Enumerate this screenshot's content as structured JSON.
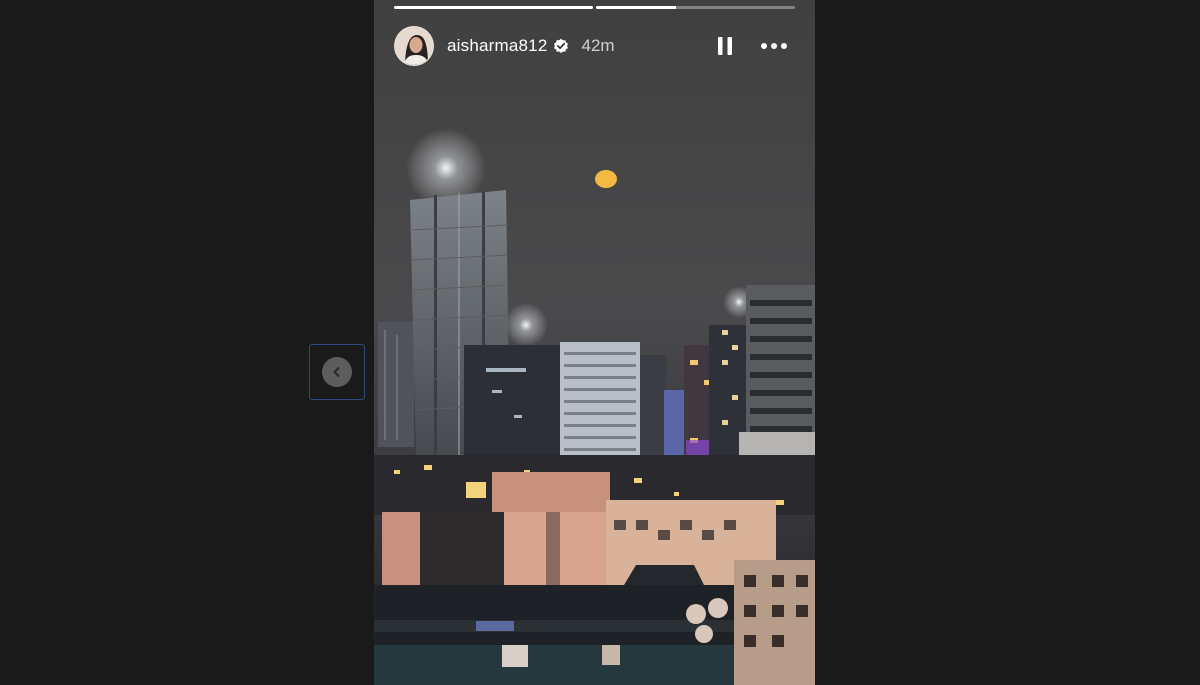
{
  "story": {
    "username": "aisharma812",
    "time_ago": "42m",
    "verified": true,
    "segments": [
      {
        "progress": 1.0
      },
      {
        "progress": 0.4
      }
    ]
  },
  "controls": {
    "pause_icon": "pause-icon",
    "more_icon": "more-options-icon",
    "prev_icon": "chevron-left-icon"
  },
  "colors": {
    "background": "#1a1a1a",
    "nav_outline": "#2f4a80",
    "moon": "#f4b942"
  }
}
